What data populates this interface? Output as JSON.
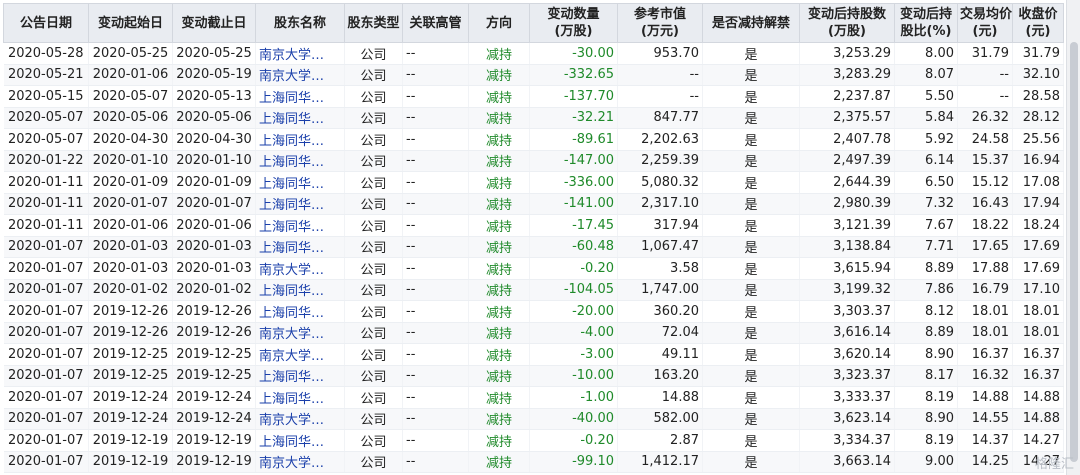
{
  "table": {
    "headers": [
      "公告日期",
      "变动起始日",
      "变动截止日",
      "股东名称",
      "股东类型",
      "关联高管",
      "方向",
      "变动数量\n(万股)",
      "参考市值\n(万元)",
      "是否减持解禁",
      "变动后持股数\n(万股)",
      "变动后持\n股比(%)",
      "交易均价\n(元)",
      "收盘价\n(元)"
    ],
    "rows": [
      [
        "2020-05-28",
        "2020-05-25",
        "2020-05-25",
        "南京大学…",
        "公司",
        "--",
        "减持",
        "-30.00",
        "953.70",
        "是",
        "3,253.29",
        "8.00",
        "31.79",
        "31.79"
      ],
      [
        "2020-05-21",
        "2020-01-06",
        "2020-05-19",
        "南京大学…",
        "公司",
        "--",
        "减持",
        "-332.65",
        "--",
        "是",
        "3,283.29",
        "8.07",
        "--",
        "32.10"
      ],
      [
        "2020-05-15",
        "2020-05-07",
        "2020-05-13",
        "上海同华…",
        "公司",
        "--",
        "减持",
        "-137.70",
        "--",
        "是",
        "2,237.87",
        "5.50",
        "--",
        "28.58"
      ],
      [
        "2020-05-07",
        "2020-05-06",
        "2020-05-06",
        "上海同华…",
        "公司",
        "--",
        "减持",
        "-32.21",
        "847.77",
        "是",
        "2,375.57",
        "5.84",
        "26.32",
        "28.12"
      ],
      [
        "2020-05-07",
        "2020-04-30",
        "2020-04-30",
        "上海同华…",
        "公司",
        "--",
        "减持",
        "-89.61",
        "2,202.63",
        "是",
        "2,407.78",
        "5.92",
        "24.58",
        "25.56"
      ],
      [
        "2020-01-22",
        "2020-01-10",
        "2020-01-10",
        "上海同华…",
        "公司",
        "--",
        "减持",
        "-147.00",
        "2,259.39",
        "是",
        "2,497.39",
        "6.14",
        "15.37",
        "16.94"
      ],
      [
        "2020-01-11",
        "2020-01-09",
        "2020-01-09",
        "上海同华…",
        "公司",
        "--",
        "减持",
        "-336.00",
        "5,080.32",
        "是",
        "2,644.39",
        "6.50",
        "15.12",
        "17.08"
      ],
      [
        "2020-01-11",
        "2020-01-07",
        "2020-01-07",
        "上海同华…",
        "公司",
        "--",
        "减持",
        "-141.00",
        "2,317.10",
        "是",
        "2,980.39",
        "7.32",
        "16.43",
        "17.94"
      ],
      [
        "2020-01-11",
        "2020-01-06",
        "2020-01-06",
        "上海同华…",
        "公司",
        "--",
        "减持",
        "-17.45",
        "317.94",
        "是",
        "3,121.39",
        "7.67",
        "18.22",
        "18.24"
      ],
      [
        "2020-01-07",
        "2020-01-03",
        "2020-01-03",
        "上海同华…",
        "公司",
        "--",
        "减持",
        "-60.48",
        "1,067.47",
        "是",
        "3,138.84",
        "7.71",
        "17.65",
        "17.69"
      ],
      [
        "2020-01-07",
        "2020-01-03",
        "2020-01-03",
        "南京大学…",
        "公司",
        "--",
        "减持",
        "-0.20",
        "3.58",
        "是",
        "3,615.94",
        "8.89",
        "17.88",
        "17.69"
      ],
      [
        "2020-01-07",
        "2020-01-02",
        "2020-01-02",
        "上海同华…",
        "公司",
        "--",
        "减持",
        "-104.05",
        "1,747.00",
        "是",
        "3,199.32",
        "7.86",
        "16.79",
        "17.10"
      ],
      [
        "2020-01-07",
        "2019-12-26",
        "2019-12-26",
        "上海同华…",
        "公司",
        "--",
        "减持",
        "-20.00",
        "360.20",
        "是",
        "3,303.37",
        "8.12",
        "18.01",
        "18.01"
      ],
      [
        "2020-01-07",
        "2019-12-26",
        "2019-12-26",
        "南京大学…",
        "公司",
        "--",
        "减持",
        "-4.00",
        "72.04",
        "是",
        "3,616.14",
        "8.89",
        "18.01",
        "18.01"
      ],
      [
        "2020-01-07",
        "2019-12-25",
        "2019-12-25",
        "南京大学…",
        "公司",
        "--",
        "减持",
        "-3.00",
        "49.11",
        "是",
        "3,620.14",
        "8.90",
        "16.37",
        "16.37"
      ],
      [
        "2020-01-07",
        "2019-12-25",
        "2019-12-25",
        "上海同华…",
        "公司",
        "--",
        "减持",
        "-10.00",
        "163.20",
        "是",
        "3,323.37",
        "8.17",
        "16.32",
        "16.37"
      ],
      [
        "2020-01-07",
        "2019-12-24",
        "2019-12-24",
        "上海同华…",
        "公司",
        "--",
        "减持",
        "-1.00",
        "14.88",
        "是",
        "3,333.37",
        "8.19",
        "14.88",
        "14.88"
      ],
      [
        "2020-01-07",
        "2019-12-24",
        "2019-12-24",
        "南京大学…",
        "公司",
        "--",
        "减持",
        "-40.00",
        "582.00",
        "是",
        "3,623.14",
        "8.90",
        "14.55",
        "14.88"
      ],
      [
        "2020-01-07",
        "2019-12-19",
        "2019-12-19",
        "上海同华…",
        "公司",
        "--",
        "减持",
        "-0.20",
        "2.87",
        "是",
        "3,334.37",
        "8.19",
        "14.37",
        "14.27"
      ],
      [
        "2020-01-07",
        "2019-12-19",
        "2019-12-19",
        "南京大学…",
        "公司",
        "--",
        "减持",
        "-99.10",
        "1,412.17",
        "是",
        "3,663.14",
        "9.00",
        "14.25",
        "14.27"
      ]
    ]
  },
  "watermark": "格隆汇"
}
